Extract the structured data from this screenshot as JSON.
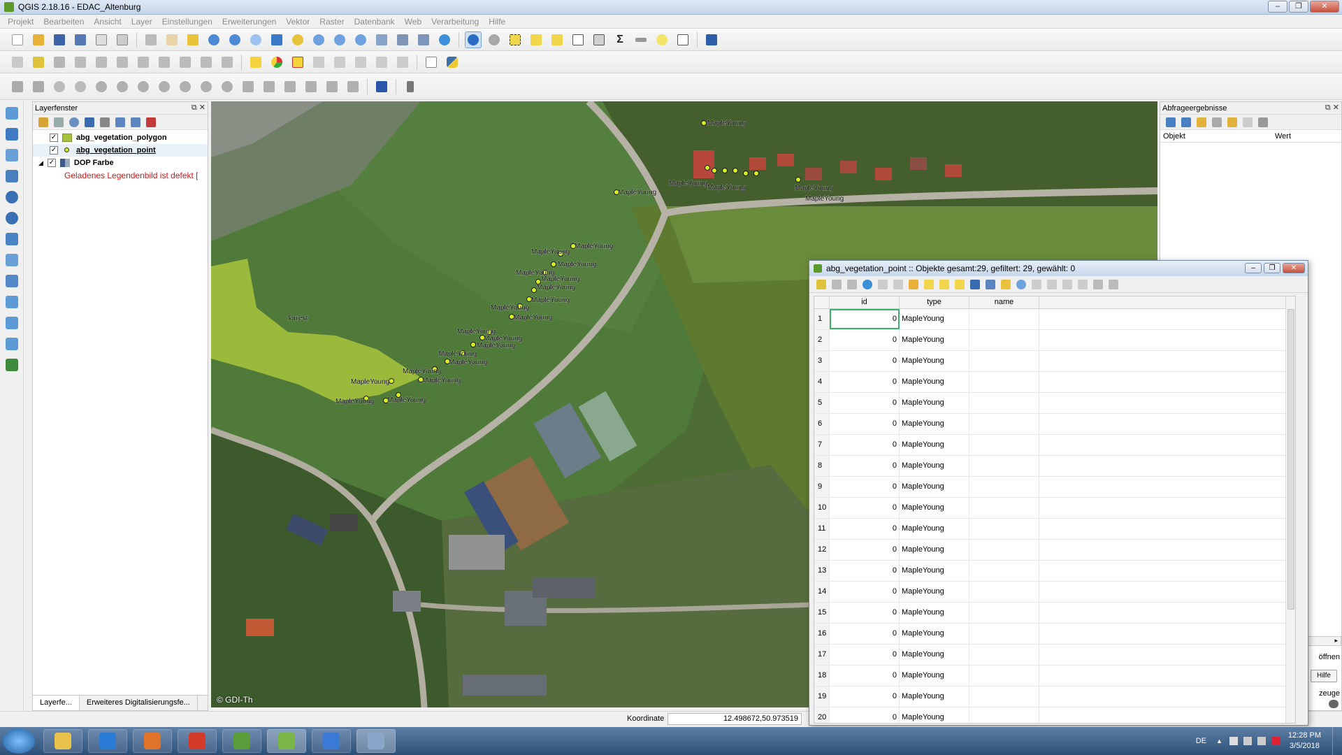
{
  "window": {
    "title": "QGIS 2.18.16 - EDAC_Altenburg",
    "controls": [
      "–",
      "❐",
      "✕"
    ]
  },
  "menu": [
    "Projekt",
    "Bearbeiten",
    "Ansicht",
    "Layer",
    "Einstellungen",
    "Erweiterungen",
    "Vektor",
    "Raster",
    "Datenbank",
    "Web",
    "Verarbeitung",
    "Hilfe"
  ],
  "layer_panel": {
    "title": "Layerfenster",
    "layers": [
      {
        "name": "abg_vegetation_polygon",
        "checked": "✓"
      },
      {
        "name": "abg_vegetation_point",
        "checked": "✓"
      },
      {
        "name": "DOP Farbe",
        "checked": "✓"
      }
    ],
    "legend_error": "Geladenes Legendenbild ist defekt [",
    "tabs": [
      "Layerfe...",
      "Erweiteres Digitalisierungsfe..."
    ]
  },
  "map": {
    "copyright": "© GDI-Th",
    "polygon_label": "forrest",
    "point_label": "MapleYoung",
    "polygon_color": "#a6c23a",
    "point_color": "#d8f020"
  },
  "query_panel": {
    "title": "Abfrageergebnisse",
    "col_object": "Objekt",
    "col_value": "Wert",
    "btn_open": "öffnen",
    "btn_help": "Hilfe",
    "partial_label": "zeuge"
  },
  "attribute_table": {
    "title": "abg_vegetation_point :: Objekte gesamt:29, gefiltert: 29, gewählt: 0",
    "columns": [
      "id",
      "type",
      "name"
    ],
    "rows": [
      {
        "num": "1",
        "id": "0",
        "type": "MapleYoung",
        "name": ""
      },
      {
        "num": "2",
        "id": "0",
        "type": "MapleYoung",
        "name": ""
      },
      {
        "num": "3",
        "id": "0",
        "type": "MapleYoung",
        "name": ""
      },
      {
        "num": "4",
        "id": "0",
        "type": "MapleYoung",
        "name": ""
      },
      {
        "num": "5",
        "id": "0",
        "type": "MapleYoung",
        "name": ""
      },
      {
        "num": "6",
        "id": "0",
        "type": "MapleYoung",
        "name": ""
      },
      {
        "num": "7",
        "id": "0",
        "type": "MapleYoung",
        "name": ""
      },
      {
        "num": "8",
        "id": "0",
        "type": "MapleYoung",
        "name": ""
      },
      {
        "num": "9",
        "id": "0",
        "type": "MapleYoung",
        "name": ""
      },
      {
        "num": "10",
        "id": "0",
        "type": "MapleYoung",
        "name": ""
      },
      {
        "num": "11",
        "id": "0",
        "type": "MapleYoung",
        "name": ""
      },
      {
        "num": "12",
        "id": "0",
        "type": "MapleYoung",
        "name": ""
      },
      {
        "num": "13",
        "id": "0",
        "type": "MapleYoung",
        "name": ""
      },
      {
        "num": "14",
        "id": "0",
        "type": "MapleYoung",
        "name": ""
      },
      {
        "num": "15",
        "id": "0",
        "type": "MapleYoung",
        "name": ""
      },
      {
        "num": "16",
        "id": "0",
        "type": "MapleYoung",
        "name": ""
      },
      {
        "num": "17",
        "id": "0",
        "type": "MapleYoung",
        "name": ""
      },
      {
        "num": "18",
        "id": "0",
        "type": "MapleYoung",
        "name": ""
      },
      {
        "num": "19",
        "id": "0",
        "type": "MapleYoung",
        "name": ""
      },
      {
        "num": "20",
        "id": "0",
        "type": "MapleYoung",
        "name": ""
      }
    ]
  },
  "statusbar": {
    "coord_label": "Koordinate",
    "coord_value": "12.498672,50.973519"
  },
  "taskbar": {
    "language": "DE",
    "time": "12:28 PM",
    "date": "3/5/2018",
    "apps": [
      "explorer-icon",
      "internet-explorer-icon",
      "media-player-icon",
      "pdf-reader-icon",
      "notepad-icon",
      "qgis-icon",
      "plane-app-icon",
      "remote-desktop-icon"
    ]
  }
}
